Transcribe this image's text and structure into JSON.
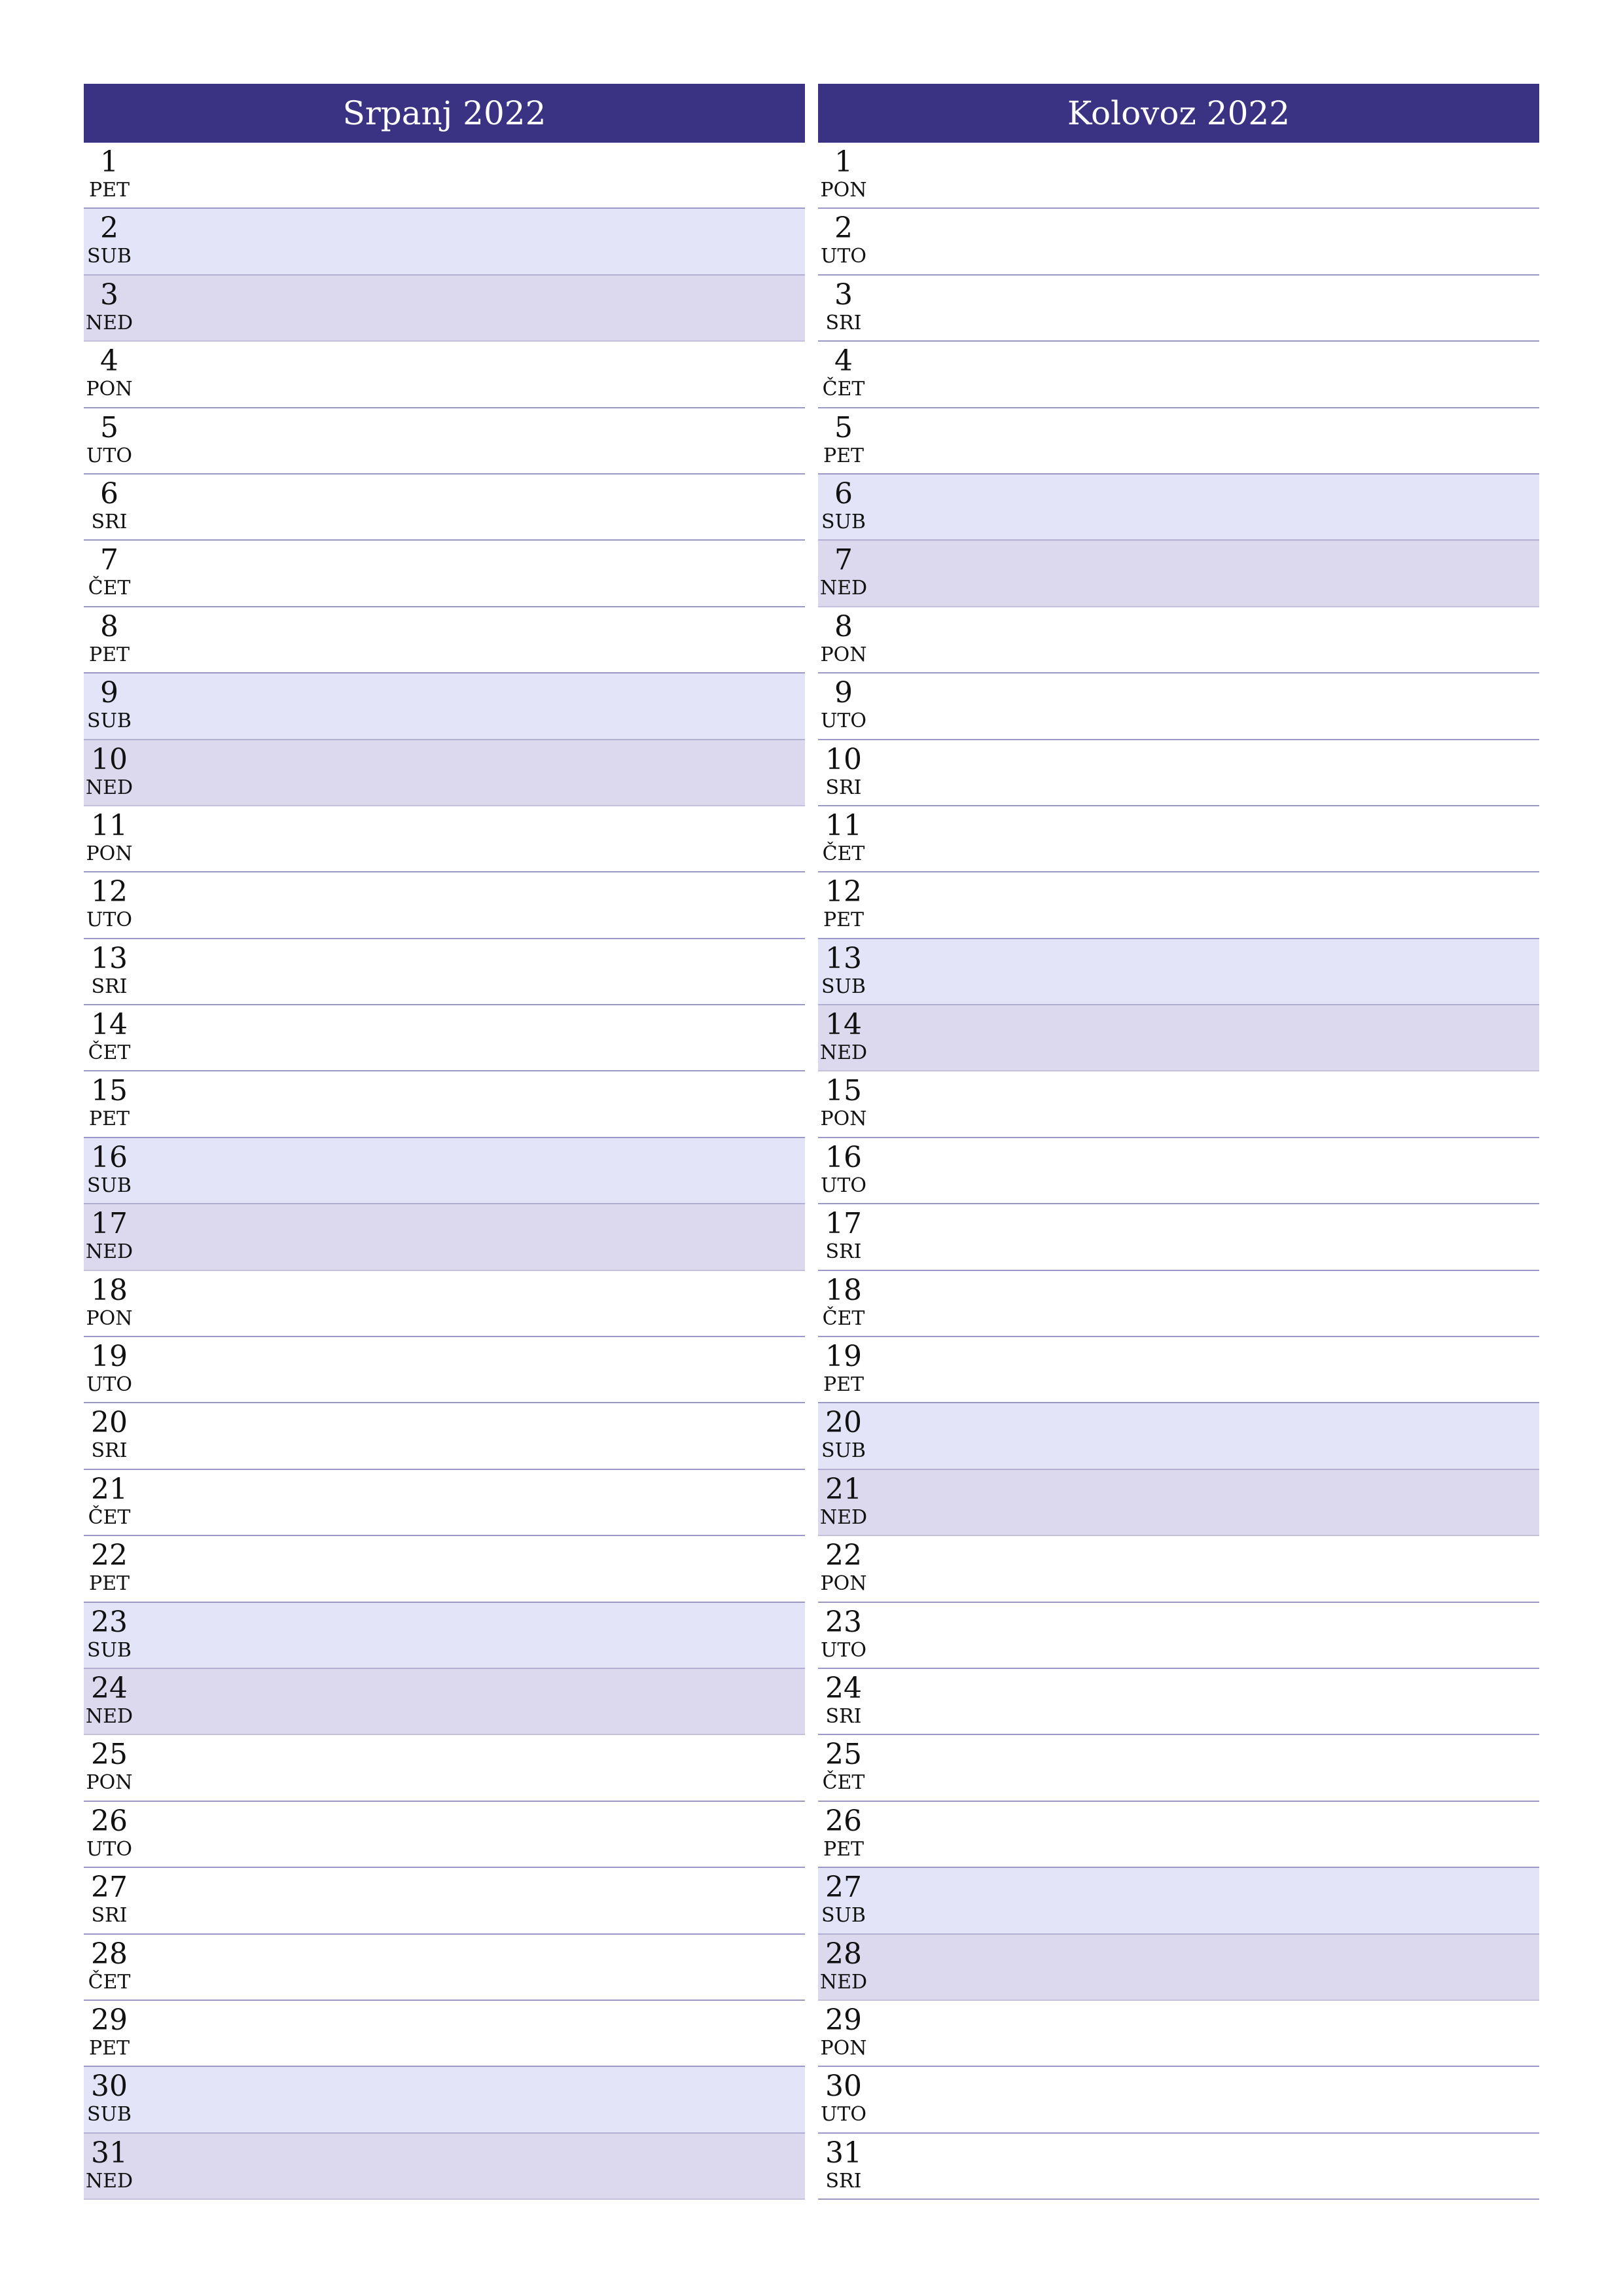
{
  "months": [
    {
      "title": "Srpanj 2022",
      "days": [
        {
          "num": "1",
          "name": "PET",
          "type": "weekday"
        },
        {
          "num": "2",
          "name": "SUB",
          "type": "sat"
        },
        {
          "num": "3",
          "name": "NED",
          "type": "sun"
        },
        {
          "num": "4",
          "name": "PON",
          "type": "weekday"
        },
        {
          "num": "5",
          "name": "UTO",
          "type": "weekday"
        },
        {
          "num": "6",
          "name": "SRI",
          "type": "weekday"
        },
        {
          "num": "7",
          "name": "ČET",
          "type": "weekday"
        },
        {
          "num": "8",
          "name": "PET",
          "type": "weekday"
        },
        {
          "num": "9",
          "name": "SUB",
          "type": "sat"
        },
        {
          "num": "10",
          "name": "NED",
          "type": "sun"
        },
        {
          "num": "11",
          "name": "PON",
          "type": "weekday"
        },
        {
          "num": "12",
          "name": "UTO",
          "type": "weekday"
        },
        {
          "num": "13",
          "name": "SRI",
          "type": "weekday"
        },
        {
          "num": "14",
          "name": "ČET",
          "type": "weekday"
        },
        {
          "num": "15",
          "name": "PET",
          "type": "weekday"
        },
        {
          "num": "16",
          "name": "SUB",
          "type": "sat"
        },
        {
          "num": "17",
          "name": "NED",
          "type": "sun"
        },
        {
          "num": "18",
          "name": "PON",
          "type": "weekday"
        },
        {
          "num": "19",
          "name": "UTO",
          "type": "weekday"
        },
        {
          "num": "20",
          "name": "SRI",
          "type": "weekday"
        },
        {
          "num": "21",
          "name": "ČET",
          "type": "weekday"
        },
        {
          "num": "22",
          "name": "PET",
          "type": "weekday"
        },
        {
          "num": "23",
          "name": "SUB",
          "type": "sat"
        },
        {
          "num": "24",
          "name": "NED",
          "type": "sun"
        },
        {
          "num": "25",
          "name": "PON",
          "type": "weekday"
        },
        {
          "num": "26",
          "name": "UTO",
          "type": "weekday"
        },
        {
          "num": "27",
          "name": "SRI",
          "type": "weekday"
        },
        {
          "num": "28",
          "name": "ČET",
          "type": "weekday"
        },
        {
          "num": "29",
          "name": "PET",
          "type": "weekday"
        },
        {
          "num": "30",
          "name": "SUB",
          "type": "sat"
        },
        {
          "num": "31",
          "name": "NED",
          "type": "sun"
        }
      ]
    },
    {
      "title": "Kolovoz 2022",
      "days": [
        {
          "num": "1",
          "name": "PON",
          "type": "weekday"
        },
        {
          "num": "2",
          "name": "UTO",
          "type": "weekday"
        },
        {
          "num": "3",
          "name": "SRI",
          "type": "weekday"
        },
        {
          "num": "4",
          "name": "ČET",
          "type": "weekday"
        },
        {
          "num": "5",
          "name": "PET",
          "type": "weekday"
        },
        {
          "num": "6",
          "name": "SUB",
          "type": "sat"
        },
        {
          "num": "7",
          "name": "NED",
          "type": "sun"
        },
        {
          "num": "8",
          "name": "PON",
          "type": "weekday"
        },
        {
          "num": "9",
          "name": "UTO",
          "type": "weekday"
        },
        {
          "num": "10",
          "name": "SRI",
          "type": "weekday"
        },
        {
          "num": "11",
          "name": "ČET",
          "type": "weekday"
        },
        {
          "num": "12",
          "name": "PET",
          "type": "weekday"
        },
        {
          "num": "13",
          "name": "SUB",
          "type": "sat"
        },
        {
          "num": "14",
          "name": "NED",
          "type": "sun"
        },
        {
          "num": "15",
          "name": "PON",
          "type": "weekday"
        },
        {
          "num": "16",
          "name": "UTO",
          "type": "weekday"
        },
        {
          "num": "17",
          "name": "SRI",
          "type": "weekday"
        },
        {
          "num": "18",
          "name": "ČET",
          "type": "weekday"
        },
        {
          "num": "19",
          "name": "PET",
          "type": "weekday"
        },
        {
          "num": "20",
          "name": "SUB",
          "type": "sat"
        },
        {
          "num": "21",
          "name": "NED",
          "type": "sun"
        },
        {
          "num": "22",
          "name": "PON",
          "type": "weekday"
        },
        {
          "num": "23",
          "name": "UTO",
          "type": "weekday"
        },
        {
          "num": "24",
          "name": "SRI",
          "type": "weekday"
        },
        {
          "num": "25",
          "name": "ČET",
          "type": "weekday"
        },
        {
          "num": "26",
          "name": "PET",
          "type": "weekday"
        },
        {
          "num": "27",
          "name": "SUB",
          "type": "sat"
        },
        {
          "num": "28",
          "name": "NED",
          "type": "sun"
        },
        {
          "num": "29",
          "name": "PON",
          "type": "weekday"
        },
        {
          "num": "30",
          "name": "UTO",
          "type": "weekday"
        },
        {
          "num": "31",
          "name": "SRI",
          "type": "weekday"
        }
      ]
    }
  ],
  "colors": {
    "header_bg": "#3a3383",
    "header_text": "#ffffff",
    "saturday_bg": "#e4e4f8",
    "sunday_bg": "#dcd8ee",
    "row_border": "#9b97c7"
  }
}
